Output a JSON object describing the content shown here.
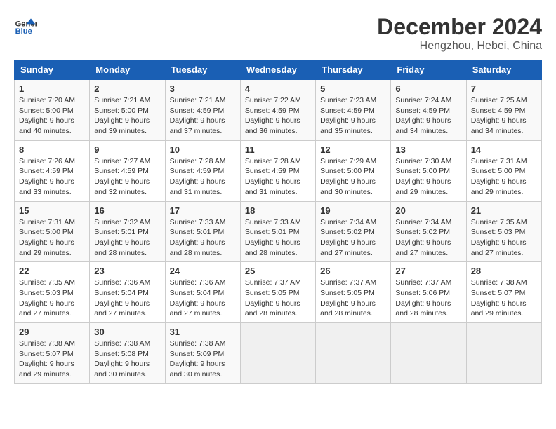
{
  "logo": {
    "line1": "General",
    "line2": "Blue"
  },
  "title": "December 2024",
  "location": "Hengzhou, Hebei, China",
  "weekdays": [
    "Sunday",
    "Monday",
    "Tuesday",
    "Wednesday",
    "Thursday",
    "Friday",
    "Saturday"
  ],
  "weeks": [
    [
      {
        "day": "1",
        "sunrise": "7:20 AM",
        "sunset": "5:00 PM",
        "daylight": "9 hours and 40 minutes."
      },
      {
        "day": "2",
        "sunrise": "7:21 AM",
        "sunset": "5:00 PM",
        "daylight": "9 hours and 39 minutes."
      },
      {
        "day": "3",
        "sunrise": "7:21 AM",
        "sunset": "4:59 PM",
        "daylight": "9 hours and 37 minutes."
      },
      {
        "day": "4",
        "sunrise": "7:22 AM",
        "sunset": "4:59 PM",
        "daylight": "9 hours and 36 minutes."
      },
      {
        "day": "5",
        "sunrise": "7:23 AM",
        "sunset": "4:59 PM",
        "daylight": "9 hours and 35 minutes."
      },
      {
        "day": "6",
        "sunrise": "7:24 AM",
        "sunset": "4:59 PM",
        "daylight": "9 hours and 34 minutes."
      },
      {
        "day": "7",
        "sunrise": "7:25 AM",
        "sunset": "4:59 PM",
        "daylight": "9 hours and 34 minutes."
      }
    ],
    [
      {
        "day": "8",
        "sunrise": "7:26 AM",
        "sunset": "4:59 PM",
        "daylight": "9 hours and 33 minutes."
      },
      {
        "day": "9",
        "sunrise": "7:27 AM",
        "sunset": "4:59 PM",
        "daylight": "9 hours and 32 minutes."
      },
      {
        "day": "10",
        "sunrise": "7:28 AM",
        "sunset": "4:59 PM",
        "daylight": "9 hours and 31 minutes."
      },
      {
        "day": "11",
        "sunrise": "7:28 AM",
        "sunset": "4:59 PM",
        "daylight": "9 hours and 31 minutes."
      },
      {
        "day": "12",
        "sunrise": "7:29 AM",
        "sunset": "5:00 PM",
        "daylight": "9 hours and 30 minutes."
      },
      {
        "day": "13",
        "sunrise": "7:30 AM",
        "sunset": "5:00 PM",
        "daylight": "9 hours and 29 minutes."
      },
      {
        "day": "14",
        "sunrise": "7:31 AM",
        "sunset": "5:00 PM",
        "daylight": "9 hours and 29 minutes."
      }
    ],
    [
      {
        "day": "15",
        "sunrise": "7:31 AM",
        "sunset": "5:00 PM",
        "daylight": "9 hours and 29 minutes."
      },
      {
        "day": "16",
        "sunrise": "7:32 AM",
        "sunset": "5:01 PM",
        "daylight": "9 hours and 28 minutes."
      },
      {
        "day": "17",
        "sunrise": "7:33 AM",
        "sunset": "5:01 PM",
        "daylight": "9 hours and 28 minutes."
      },
      {
        "day": "18",
        "sunrise": "7:33 AM",
        "sunset": "5:01 PM",
        "daylight": "9 hours and 28 minutes."
      },
      {
        "day": "19",
        "sunrise": "7:34 AM",
        "sunset": "5:02 PM",
        "daylight": "9 hours and 27 minutes."
      },
      {
        "day": "20",
        "sunrise": "7:34 AM",
        "sunset": "5:02 PM",
        "daylight": "9 hours and 27 minutes."
      },
      {
        "day": "21",
        "sunrise": "7:35 AM",
        "sunset": "5:03 PM",
        "daylight": "9 hours and 27 minutes."
      }
    ],
    [
      {
        "day": "22",
        "sunrise": "7:35 AM",
        "sunset": "5:03 PM",
        "daylight": "9 hours and 27 minutes."
      },
      {
        "day": "23",
        "sunrise": "7:36 AM",
        "sunset": "5:04 PM",
        "daylight": "9 hours and 27 minutes."
      },
      {
        "day": "24",
        "sunrise": "7:36 AM",
        "sunset": "5:04 PM",
        "daylight": "9 hours and 27 minutes."
      },
      {
        "day": "25",
        "sunrise": "7:37 AM",
        "sunset": "5:05 PM",
        "daylight": "9 hours and 28 minutes."
      },
      {
        "day": "26",
        "sunrise": "7:37 AM",
        "sunset": "5:05 PM",
        "daylight": "9 hours and 28 minutes."
      },
      {
        "day": "27",
        "sunrise": "7:37 AM",
        "sunset": "5:06 PM",
        "daylight": "9 hours and 28 minutes."
      },
      {
        "day": "28",
        "sunrise": "7:38 AM",
        "sunset": "5:07 PM",
        "daylight": "9 hours and 29 minutes."
      }
    ],
    [
      {
        "day": "29",
        "sunrise": "7:38 AM",
        "sunset": "5:07 PM",
        "daylight": "9 hours and 29 minutes."
      },
      {
        "day": "30",
        "sunrise": "7:38 AM",
        "sunset": "5:08 PM",
        "daylight": "9 hours and 30 minutes."
      },
      {
        "day": "31",
        "sunrise": "7:38 AM",
        "sunset": "5:09 PM",
        "daylight": "9 hours and 30 minutes."
      },
      null,
      null,
      null,
      null
    ]
  ]
}
